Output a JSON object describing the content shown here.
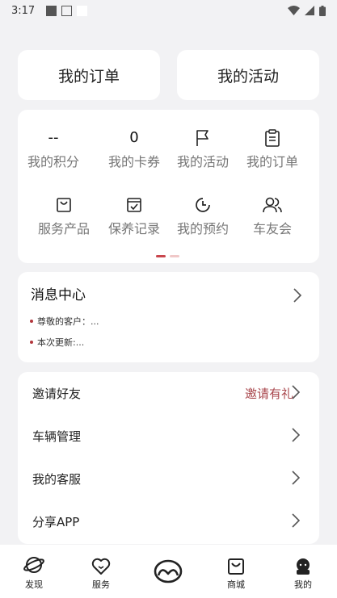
{
  "status_bar": {
    "time": "3:17"
  },
  "top_buttons": {
    "orders": "我的订单",
    "activities": "我的活动"
  },
  "grid": {
    "points": {
      "value": "--",
      "label": "我的积分"
    },
    "coupons": {
      "value": "0",
      "label": "我的卡券"
    },
    "activities": {
      "label": "我的活动",
      "icon": "flag-icon"
    },
    "orders": {
      "label": "我的订单",
      "icon": "clipboard-icon"
    },
    "service_products": {
      "label": "服务产品",
      "icon": "bag-icon"
    },
    "maintenance": {
      "label": "保养记录",
      "icon": "calendar-check-icon"
    },
    "appointments": {
      "label": "我的预约",
      "icon": "clock-icon"
    },
    "club": {
      "label": "车友会",
      "icon": "users-icon"
    }
  },
  "messages": {
    "title": "消息中心",
    "items": [
      "尊敬的客户：...",
      "本次更新:..."
    ]
  },
  "menu": {
    "invite": {
      "label": "邀请好友",
      "extra": "邀请有礼"
    },
    "vehicles": {
      "label": "车辆管理"
    },
    "support": {
      "label": "我的客服"
    },
    "share": {
      "label": "分享APP"
    }
  },
  "tabs": {
    "discover": "发现",
    "service": "服务",
    "mall": "商城",
    "mine": "我的"
  },
  "colors": {
    "accent": "#c9464d",
    "invite_text": "#a8454b"
  }
}
